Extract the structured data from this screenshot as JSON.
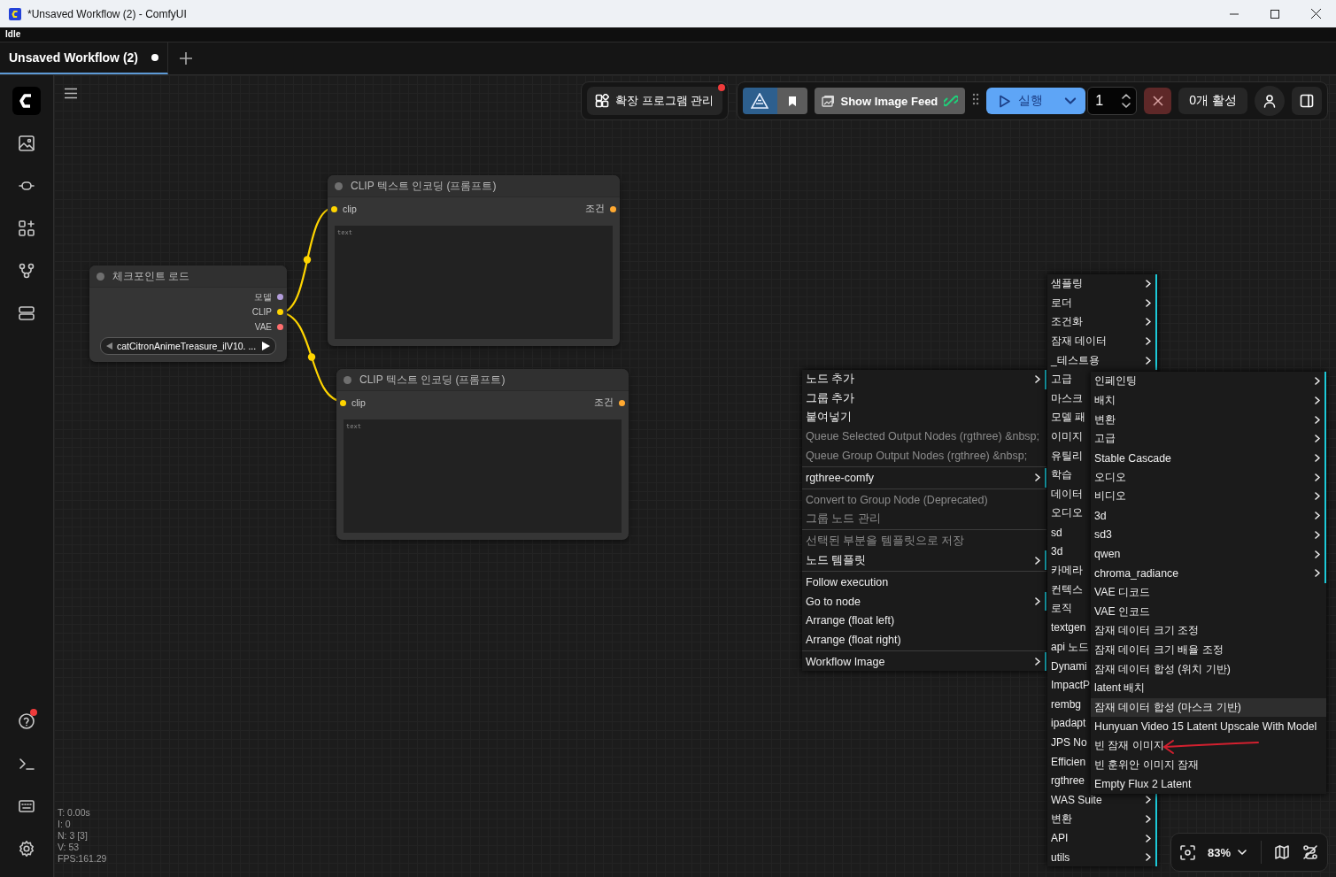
{
  "window": {
    "title": "*Unsaved Workflow (2) - ComfyUI"
  },
  "status": "Idle",
  "tabs": [
    {
      "label": "Unsaved Workflow (2)",
      "selected": true,
      "modified": true
    }
  ],
  "sidebar": {
    "help_notification": true
  },
  "toolbar": {
    "extensions": {
      "label": "확장 프로그램 관리",
      "notification": true
    },
    "image_feed": {
      "label": "Show Image Feed"
    },
    "run": {
      "label": "실행"
    },
    "batch_count": {
      "value": "1"
    },
    "active_count": {
      "label": "0개 활성"
    }
  },
  "nodes": [
    {
      "title": "체크포인트 로드",
      "outputs": [
        {
          "label": "모델",
          "color": "#b39ddb"
        },
        {
          "label": "CLIP",
          "color": "#ffd500"
        },
        {
          "label": "VAE",
          "color": "#ff6e6e"
        }
      ],
      "widget": {
        "value": "catCitronAnimeTreasure_ilV10. ..."
      }
    },
    {
      "title": "CLIP 텍스트 인코딩 (프롬프트)",
      "inputs": [
        {
          "label": "clip",
          "color": "#ffd500"
        }
      ],
      "outputs": [
        {
          "label": "조건",
          "color": "#ffa931"
        }
      ],
      "text_placeholder": "text"
    },
    {
      "title": "CLIP 텍스트 인코딩 (프롬프트)",
      "inputs": [
        {
          "label": "clip",
          "color": "#ffd500"
        }
      ],
      "outputs": [
        {
          "label": "조건",
          "color": "#ffa931"
        }
      ],
      "text_placeholder": "text"
    }
  ],
  "stats": [
    "T: 0.00s",
    "I: 0",
    "N: 3 [3]",
    "V: 53",
    "FPS:161.29"
  ],
  "context_menu": {
    "sections": [
      [
        {
          "label": "노드 추가",
          "disabled": false,
          "submenu": true
        },
        {
          "label": "그룹 추가",
          "disabled": false,
          "submenu": false
        },
        {
          "label": "붙여넣기",
          "disabled": false,
          "submenu": false
        },
        {
          "label": "Queue Selected Output Nodes (rgthree) &nbsp;",
          "disabled": true,
          "submenu": false
        },
        {
          "label": "Queue Group Output Nodes (rgthree) &nbsp;",
          "disabled": true,
          "submenu": false
        }
      ],
      [
        {
          "label": "rgthree-comfy",
          "disabled": false,
          "submenu": true
        }
      ],
      [
        {
          "label": "Convert to Group Node (Deprecated)",
          "disabled": true,
          "submenu": false
        },
        {
          "label": "그룹 노드 관리",
          "disabled": true,
          "submenu": false
        }
      ],
      [
        {
          "label": "선택된 부분을 템플릿으로 저장",
          "disabled": true,
          "submenu": false
        },
        {
          "label": "노드 템플릿",
          "disabled": false,
          "submenu": true
        }
      ],
      [
        {
          "label": "Follow execution",
          "disabled": false,
          "submenu": false
        },
        {
          "label": "Go to node",
          "disabled": false,
          "submenu": true
        },
        {
          "label": "Arrange (float left)",
          "disabled": false,
          "submenu": false
        },
        {
          "label": "Arrange (float right)",
          "disabled": false,
          "submenu": false
        }
      ],
      [
        {
          "label": "Workflow Image",
          "disabled": false,
          "submenu": true
        }
      ]
    ]
  },
  "category_menu": {
    "items": [
      {
        "label": "샘플링",
        "submenu": true
      },
      {
        "label": "로더",
        "submenu": true
      },
      {
        "label": "조건화",
        "submenu": true
      },
      {
        "label": "잠재 데이터",
        "submenu": true
      },
      {
        "label": "_테스트용",
        "submenu": true
      },
      {
        "label": "고급"
      },
      {
        "label": "마스크"
      },
      {
        "label": "모델 패"
      },
      {
        "label": "이미지"
      },
      {
        "label": "유틸리"
      },
      {
        "label": "학습"
      },
      {
        "label": "데이터"
      },
      {
        "label": "오디오"
      },
      {
        "label": "sd"
      },
      {
        "label": "3d"
      },
      {
        "label": "카메라"
      },
      {
        "label": "컨텍스"
      },
      {
        "label": "로직"
      },
      {
        "label": "textgen"
      },
      {
        "label": "api 노드"
      },
      {
        "label": "Dynami"
      },
      {
        "label": "ImpactP"
      },
      {
        "label": "rembg"
      },
      {
        "label": "ipadapt"
      },
      {
        "label": "JPS No"
      },
      {
        "label": "Efficien"
      },
      {
        "label": "rgthree"
      },
      {
        "label": "WAS Suite",
        "submenu": true
      },
      {
        "label": "변환",
        "submenu": true
      },
      {
        "label": "API",
        "submenu": true
      },
      {
        "label": "utils",
        "submenu": true
      }
    ]
  },
  "node_menu": {
    "items": [
      {
        "label": "인페인팅",
        "submenu": true,
        "selected": false
      },
      {
        "label": "배치",
        "submenu": true,
        "selected": false
      },
      {
        "label": "변환",
        "submenu": true,
        "selected": false
      },
      {
        "label": "고급",
        "submenu": true,
        "selected": false
      },
      {
        "label": "Stable Cascade",
        "submenu": true,
        "selected": false
      },
      {
        "label": "오디오",
        "submenu": true,
        "selected": false
      },
      {
        "label": "비디오",
        "submenu": true,
        "selected": false
      },
      {
        "label": "3d",
        "submenu": true,
        "selected": false
      },
      {
        "label": "sd3",
        "submenu": true,
        "selected": false
      },
      {
        "label": "qwen",
        "submenu": true,
        "selected": false
      },
      {
        "label": "chroma_radiance",
        "submenu": true,
        "selected": false
      },
      {
        "label": "VAE 디코드",
        "submenu": false,
        "selected": false
      },
      {
        "label": "VAE 인코드",
        "submenu": false,
        "selected": false
      },
      {
        "label": "잠재 데이터 크기 조정",
        "submenu": false,
        "selected": false
      },
      {
        "label": "잠재 데이터 크기 배율 조정",
        "submenu": false,
        "selected": false
      },
      {
        "label": "잠재 데이터 합성 (위치 기반)",
        "submenu": false,
        "selected": false
      },
      {
        "label": "latent 배치",
        "submenu": false,
        "selected": false
      },
      {
        "label": "잠재 데이터 합성 (마스크 기반)",
        "submenu": false,
        "selected": true
      },
      {
        "label": "Hunyuan Video 15 Latent Upscale With Model",
        "submenu": false,
        "selected": false
      },
      {
        "label": "빈 잠재 이미지",
        "submenu": false,
        "selected": false
      },
      {
        "label": "빈 훈위안 이미지 잠재",
        "submenu": false,
        "selected": false
      },
      {
        "label": "Empty Flux 2 Latent",
        "submenu": false,
        "selected": false
      }
    ]
  },
  "zoom": {
    "label": "83%"
  }
}
